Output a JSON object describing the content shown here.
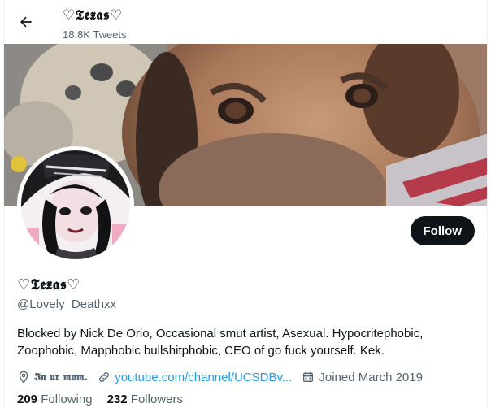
{
  "header": {
    "name": "♡𝕿𝖊𝖝𝖆𝖘♡",
    "tweet_count": "18.8K Tweets"
  },
  "profile": {
    "display_name": "♡𝕿𝖊𝖝𝖆𝖘♡",
    "handle": "@Lovely_Deathxx",
    "bio": "Blocked by Nick De Orio, Occasional smut artist, Asexual. Hypocritephobic, Zoophobic, Mapphobic bullshitphobic, CEO of go fuck yourself. Kek.",
    "follow_label": "Follow",
    "location": "𝕴𝖓 𝖚𝖗 𝖒𝖔𝖒.",
    "website": "youtube.com/channel/UCSDBv...",
    "joined": "Joined March 2019"
  },
  "stats": {
    "following_count": "209",
    "following_label": "Following",
    "followers_count": "232",
    "followers_label": "Followers"
  },
  "icons": {
    "back": "arrow-left-icon",
    "location": "location-pin-icon",
    "link": "link-icon",
    "calendar": "calendar-icon"
  },
  "colors": {
    "link": "#1d9bf0",
    "secondary_text": "#536471",
    "follow_button": "#0f1419"
  }
}
